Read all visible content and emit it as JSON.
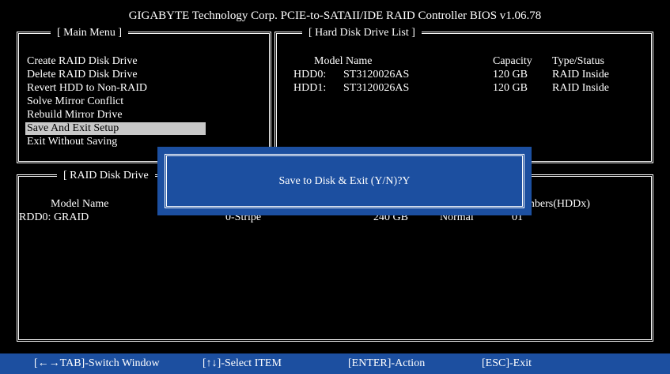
{
  "title": "GIGABYTE Technology Corp. PCIE-to-SATAII/IDE RAID Controller BIOS v1.06.78",
  "main_menu": {
    "title": "[ Main Menu ]",
    "items": [
      "Create RAID Disk Drive",
      "Delete RAID Disk Drive",
      "Revert HDD to Non-RAID",
      "Solve Mirror Conflict",
      "Rebuild Mirror Drive",
      "Save And Exit Setup",
      "Exit Without Saving"
    ],
    "selected_index": 5
  },
  "hdd_list": {
    "title": "[ Hard Disk Drive List ]",
    "headers": {
      "model": "Model Name",
      "capacity": "Capacity",
      "type": "Type/Status"
    },
    "rows": [
      {
        "id": "HDD0:",
        "model": "ST3120026AS",
        "capacity": "120 GB",
        "type": "RAID Inside"
      },
      {
        "id": "HDD1:",
        "model": "ST3120026AS",
        "capacity": "120 GB",
        "type": "RAID Inside"
      }
    ]
  },
  "raid_list": {
    "title": "[ RAID Disk Drive",
    "headers": {
      "model": "Model Name",
      "members": "mbers(HDDx)"
    },
    "rows": [
      {
        "name": "RDD0: GRAID",
        "level": "0-Stripe",
        "capacity": "240 GB",
        "status": "Normal",
        "members": "01"
      }
    ]
  },
  "dialog": {
    "message": "Save to Disk & Exit (Y/N)?Y"
  },
  "footer": {
    "switch": "[←→TAB]-Switch Window",
    "select": "[↑↓]-Select ITEM",
    "action": "[ENTER]-Action",
    "exit": "[ESC]-Exit"
  },
  "colors": {
    "background": "#000000",
    "highlight": "#c8c8c8",
    "dialog_bg": "#1c4fa0",
    "footer_bg": "#1c4fa0"
  }
}
